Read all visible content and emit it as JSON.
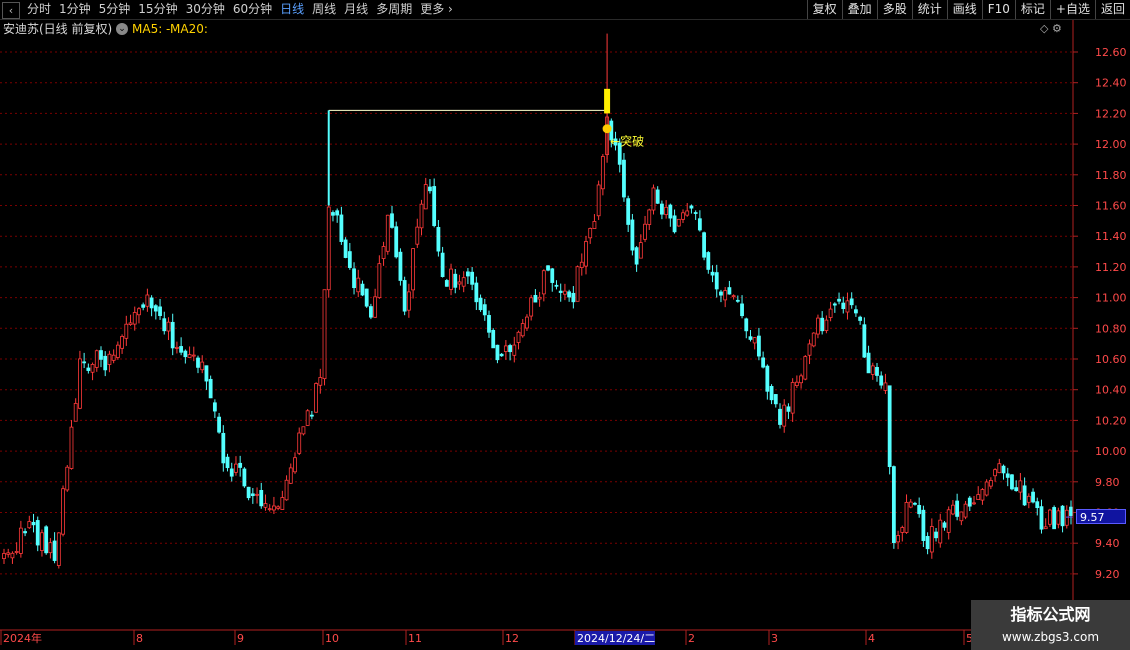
{
  "toolbar": {
    "nav_back": "‹",
    "nav_forward": "›",
    "periods": [
      "分时",
      "1分钟",
      "5分钟",
      "15分钟",
      "30分钟",
      "60分钟",
      "日线",
      "周线",
      "月线",
      "多周期",
      "更多 ›"
    ],
    "active_period": "日线",
    "right_buttons": [
      "复权",
      "叠加",
      "多股",
      "统计",
      "画线",
      "F10",
      "标记",
      "+自选",
      "返回"
    ]
  },
  "info_bar": {
    "stock_title": "安迪苏(日线 前复权)",
    "ma5_label": "MA5: -",
    "ma20_label": "MA20:",
    "tools_icons": "◇ ⚙"
  },
  "price_tag": "9.57",
  "watermark": {
    "line1": "指标公式网",
    "line2": "www.zbgs3.com"
  },
  "colors": {
    "up": "#ff3a3a",
    "down": "#54ffff",
    "grid": "#7a0000",
    "axis_text": "#ff4a4a",
    "annotation": "#ffff33",
    "background": "#000000"
  },
  "chart_data": {
    "type": "candlestick",
    "ylim": [
      9.0,
      12.8
    ],
    "y_ticks": [
      "12.60",
      "12.40",
      "12.20",
      "12.00",
      "11.80",
      "11.60",
      "11.40",
      "11.20",
      "11.00",
      "10.80",
      "10.60",
      "10.40",
      "10.20",
      "10.00",
      "9.80",
      "9.60",
      "9.40",
      "9.20"
    ],
    "x_labels": [
      "2024年",
      "8",
      "9",
      "10",
      "11",
      "12",
      "2024/12/24/二",
      "2",
      "3",
      "4",
      "5"
    ],
    "crosshair_date": "2024/12/24/二",
    "annotation": "突破",
    "breakout_level": 12.22,
    "last_price": 9.57,
    "anchors": [
      {
        "i": 0,
        "p": 9.3
      },
      {
        "i": 6,
        "p": 9.52
      },
      {
        "i": 12,
        "p": 9.3
      },
      {
        "i": 18,
        "p": 10.57
      },
      {
        "i": 26,
        "p": 10.6
      },
      {
        "i": 33,
        "p": 10.98
      },
      {
        "i": 37,
        "p": 10.85
      },
      {
        "i": 43,
        "p": 10.62
      },
      {
        "i": 48,
        "p": 10.52
      },
      {
        "i": 52,
        "p": 9.98
      },
      {
        "i": 59,
        "p": 9.72
      },
      {
        "i": 66,
        "p": 9.65
      },
      {
        "i": 70,
        "p": 10.06
      },
      {
        "i": 75,
        "p": 10.45
      },
      {
        "i": 77,
        "p": 11.65
      },
      {
        "i": 82,
        "p": 11.2
      },
      {
        "i": 87,
        "p": 10.85
      },
      {
        "i": 91,
        "p": 11.55
      },
      {
        "i": 95,
        "p": 10.9
      },
      {
        "i": 100,
        "p": 11.8
      },
      {
        "i": 104,
        "p": 11.15
      },
      {
        "i": 110,
        "p": 11.1
      },
      {
        "i": 117,
        "p": 10.62
      },
      {
        "i": 123,
        "p": 10.8
      },
      {
        "i": 129,
        "p": 11.2
      },
      {
        "i": 134,
        "p": 10.95
      },
      {
        "i": 140,
        "p": 11.5
      },
      {
        "i": 143,
        "p": 12.2
      },
      {
        "i": 147,
        "p": 11.7
      },
      {
        "i": 150,
        "p": 11.2
      },
      {
        "i": 154,
        "p": 11.75
      },
      {
        "i": 158,
        "p": 11.45
      },
      {
        "i": 163,
        "p": 11.6
      },
      {
        "i": 168,
        "p": 11.1
      },
      {
        "i": 174,
        "p": 10.95
      },
      {
        "i": 179,
        "p": 10.6
      },
      {
        "i": 184,
        "p": 10.2
      },
      {
        "i": 188,
        "p": 10.45
      },
      {
        "i": 193,
        "p": 10.8
      },
      {
        "i": 198,
        "p": 10.95
      },
      {
        "i": 202,
        "p": 10.9
      },
      {
        "i": 205,
        "p": 10.55
      },
      {
        "i": 209,
        "p": 10.4
      },
      {
        "i": 211,
        "p": 9.4
      },
      {
        "i": 215,
        "p": 9.68
      },
      {
        "i": 219,
        "p": 9.4
      },
      {
        "i": 224,
        "p": 9.6
      },
      {
        "i": 230,
        "p": 9.7
      },
      {
        "i": 236,
        "p": 9.88
      },
      {
        "i": 241,
        "p": 9.76
      },
      {
        "i": 246,
        "p": 9.55
      },
      {
        "i": 253,
        "p": 9.58
      }
    ]
  }
}
